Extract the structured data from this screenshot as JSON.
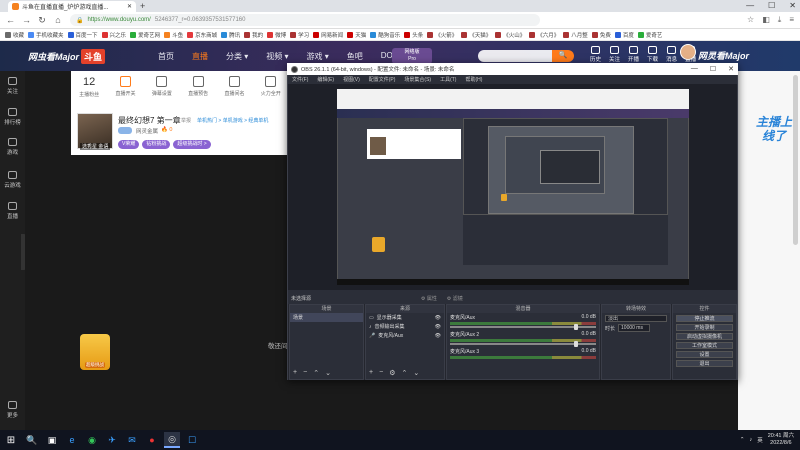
{
  "browser": {
    "tab_title": "斗鱼在直播直播_炉炉游戏直播...",
    "new_tab": "+",
    "url_host": "https://www.douyu.com/",
    "url_rest": "5246377_r=0.0639357531577160",
    "window_controls": [
      "—",
      "☐",
      "✕"
    ],
    "bookmarks": [
      {
        "label": "收藏",
        "color": "#6b6b6b"
      },
      {
        "label": "手机收藏夹",
        "color": "#4a8af4"
      },
      {
        "label": "百度一下",
        "color": "#2a5fd8"
      },
      {
        "label": "兴之乐",
        "color": "#d33"
      },
      {
        "label": "爱奇艺网",
        "color": "#2aad3a"
      },
      {
        "label": "斗鱼",
        "color": "#f58220"
      },
      {
        "label": "京东商城",
        "color": "#e4393c"
      },
      {
        "label": "腾讯",
        "color": "#2a8bd8"
      },
      {
        "label": "我的",
        "color": "#a33"
      },
      {
        "label": "微博",
        "color": "#d33"
      },
      {
        "label": "学习",
        "color": "#a33"
      },
      {
        "label": "网易新闻",
        "color": "#c00"
      },
      {
        "label": "天猫",
        "color": "#c00"
      },
      {
        "label": "酷狗音乐",
        "color": "#2a8bd8"
      },
      {
        "label": "头条",
        "color": "#c00"
      },
      {
        "label": "《火箭》",
        "color": "#a33"
      },
      {
        "label": "《天猫》",
        "color": "#a33"
      },
      {
        "label": "《火山》",
        "color": "#a33"
      },
      {
        "label": "《六月》",
        "color": "#a33"
      },
      {
        "label": "八月整",
        "color": "#a33"
      },
      {
        "label": "免费",
        "color": "#a33"
      },
      {
        "label": "百度",
        "color": "#2a5fd8"
      },
      {
        "label": "爱奇艺",
        "color": "#2aad3a"
      }
    ]
  },
  "douyu": {
    "logo_text": "网虫看Major",
    "logo_brand": "斗鱼",
    "nav": [
      "首页",
      "直播",
      "分类 ▾",
      "视频 ▾",
      "游戏 ▾",
      "鱼吧",
      "DOTA2"
    ],
    "active_nav_index": 1,
    "live_badge_line1": "网络版",
    "live_badge_line2": "Pro",
    "search_placeholder": "",
    "search_button": "🔍",
    "tools": [
      "历史",
      "关注",
      "开播",
      "下载",
      "消息",
      "直播"
    ],
    "right_logo": "网灵看Major",
    "sidebar": [
      "关注",
      "排行榜",
      "游戏",
      "云游戏",
      "直播",
      "更多"
    ],
    "stats": [
      {
        "num": "12",
        "label": "主播粉丝"
      },
      {
        "num": "",
        "label": "直播开关"
      },
      {
        "num": "",
        "label": "弹幕设置"
      },
      {
        "num": "",
        "label": "直播预告"
      },
      {
        "num": "",
        "label": "直播间名"
      },
      {
        "num": "",
        "label": "火力全开"
      }
    ],
    "room": {
      "title": "最终幻想7 第一章",
      "report": "举报",
      "categories": "单机热门 > 单机游戏 > 经典单机",
      "anchor": "网灵金属",
      "hot": "🔥 0",
      "name_tag": "选秀星 金语",
      "buttons": [
        {
          "label": "V荣耀",
          "color": "#8a63d2"
        },
        {
          "label": "钻粉挑战",
          "color": "#8a63d2"
        },
        {
          "label": "超级挑战时 >",
          "color": "#8a63d2"
        }
      ]
    },
    "gift_label": "超级挑战",
    "chat_peek": "敬还间",
    "promo": "主播上线了"
  },
  "obs": {
    "title": "OBS 26.1.1 (64-bit, windows) - 配置文件: 未命名 - 场景: 未命名",
    "menu": [
      "文件(F)",
      "编辑(E)",
      "视图(V)",
      "配置文件(P)",
      "场景集合(S)",
      "工具(T)",
      "帮助(H)"
    ],
    "source_bar_label": "未选择源",
    "source_bar_props": "⚙ 属性",
    "source_bar_filters": "⚙ 滤镜",
    "docks": {
      "scenes": {
        "title": "场景",
        "items": [
          "场景"
        ]
      },
      "sources": {
        "title": "来源",
        "items": [
          "显示器采集",
          "音频输出采集",
          "麦克风/Aux"
        ]
      },
      "mixer": {
        "title": "混音器",
        "channels": [
          {
            "name": "麦克风/Aux",
            "db": "0.0 dB"
          },
          {
            "name": "麦克风/Aux 2",
            "db": "0.0 dB"
          },
          {
            "name": "麦克风/Aux 3",
            "db": "0.0 dB"
          }
        ]
      },
      "transitions": {
        "title": "转场特效",
        "selected": "淡出",
        "duration_label": "时长",
        "duration_value": "10000 ms"
      },
      "controls": {
        "title": "控件",
        "buttons": [
          "停止推流",
          "开始录制",
          "启动虚拟摄像机",
          "工作室模式",
          "设置",
          "退出"
        ]
      }
    }
  },
  "taskbar": {
    "start_icon": "⊞",
    "icons": [
      "🔍",
      "▣",
      "e",
      "◉",
      "✈",
      "✉",
      "●",
      "◎",
      "☐"
    ],
    "active_index": 7,
    "tray": [
      "⌃",
      "♪",
      "英"
    ],
    "time": "20:41 周六",
    "date": "2022/8/6"
  }
}
